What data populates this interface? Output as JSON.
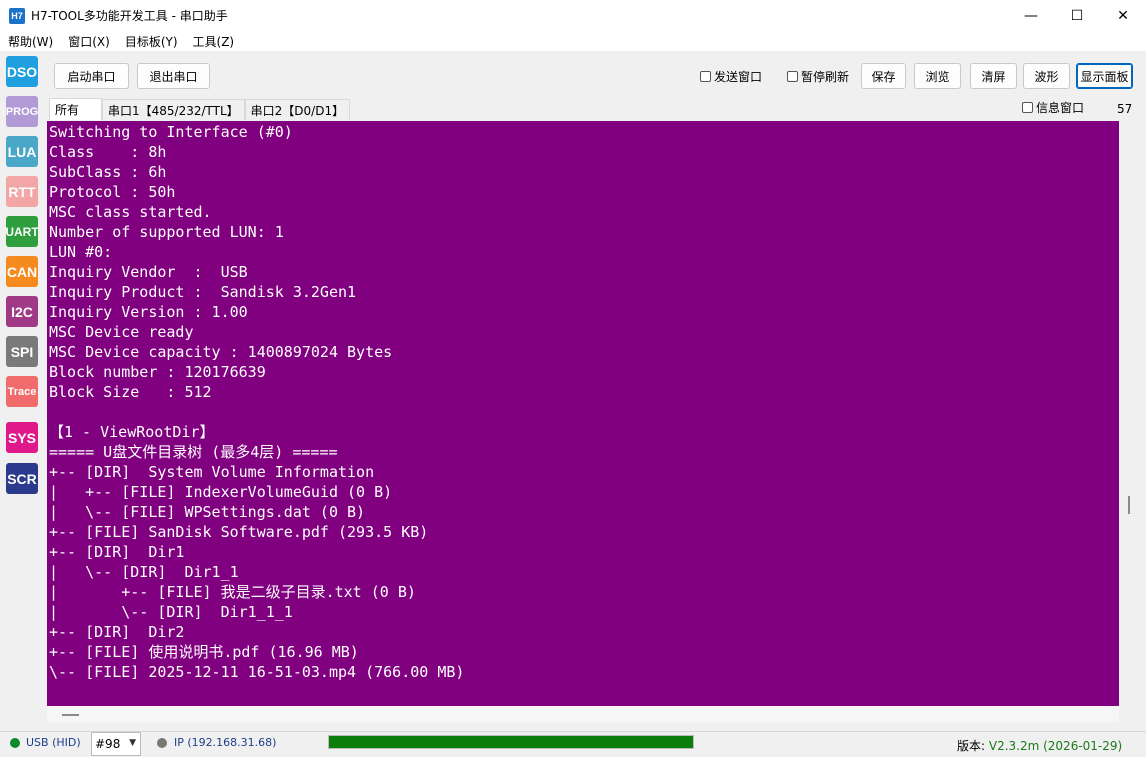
{
  "window": {
    "icon_text": "H7",
    "title": "H7-TOOL多功能开发工具 - 串口助手",
    "minimize": "—",
    "maximize": "☐",
    "close": "✕"
  },
  "menu": [
    "帮助(W)",
    "窗口(X)",
    "目标板(Y)",
    "工具(Z)"
  ],
  "sidebar": [
    {
      "label": "DSO",
      "color": "#1f9fe0"
    },
    {
      "label": "PROG",
      "color": "#b29ad6"
    },
    {
      "label": "LUA",
      "color": "#4aa7c8"
    },
    {
      "label": "RTT",
      "color": "#f2a6a6"
    },
    {
      "label": "UART",
      "color": "#2e9e3e"
    },
    {
      "label": "CAN",
      "color": "#f58a1f"
    },
    {
      "label": "I2C",
      "color": "#a03a86"
    },
    {
      "label": "SPI",
      "color": "#7a7a7a"
    },
    {
      "label": "Trace",
      "color": "#f06b6b"
    },
    {
      "label": "SYS",
      "color": "#e0198a"
    },
    {
      "label": "SCR",
      "color": "#2b3a8c"
    }
  ],
  "toolbar": {
    "start_port": "启动串口",
    "exit_port": "退出串口",
    "send_window": "发送窗口",
    "pause_refresh": "暂停刷新",
    "save": "保存",
    "browse": "浏览",
    "clear": "清屏",
    "waveform": "波形",
    "show_panel": "显示面板"
  },
  "tabs": [
    "所有",
    "串口1【485/232/TTL】",
    "串口2【D0/D1】"
  ],
  "info_window": "信息窗口",
  "line_count": "57",
  "console_lines": [
    "Switching to Interface (#0)",
    "Class    : 8h",
    "SubClass : 6h",
    "Protocol : 50h",
    "MSC class started.",
    "Number of supported LUN: 1",
    "LUN #0:",
    "Inquiry Vendor  :  USB",
    "Inquiry Product :  Sandisk 3.2Gen1",
    "Inquiry Version : 1.00",
    "MSC Device ready",
    "MSC Device capacity : 1400897024 Bytes",
    "Block number : 120176639",
    "Block Size   : 512",
    "",
    "【1 - ViewRootDir】",
    "===== U盘文件目录树 (最多4层) =====",
    "+-- [DIR]  System Volume Information",
    "|   +-- [FILE] IndexerVolumeGuid (0 B)",
    "|   \\-- [FILE] WPSettings.dat (0 B)",
    "+-- [FILE] SanDisk Software.pdf (293.5 KB)",
    "+-- [DIR]  Dir1",
    "|   \\-- [DIR]  Dir1_1",
    "|       +-- [FILE] 我是二级子目录.txt (0 B)",
    "|       \\-- [DIR]  Dir1_1_1",
    "+-- [DIR]  Dir2",
    "+-- [FILE] 使用说明书.pdf (16.96 MB)",
    "\\-- [FILE] 2025-12-11 16-51-03.mp4 (766.00 MB)"
  ],
  "status": {
    "usb": "USB (HID)",
    "usb_color": "#0a8a2a",
    "port": "#98",
    "ip": "IP (192.168.31.68)",
    "ip_color": "#777777",
    "progress": 1.0,
    "version_label": "版本: ",
    "version_value": "V2.3.2m (2026-01-29)"
  }
}
